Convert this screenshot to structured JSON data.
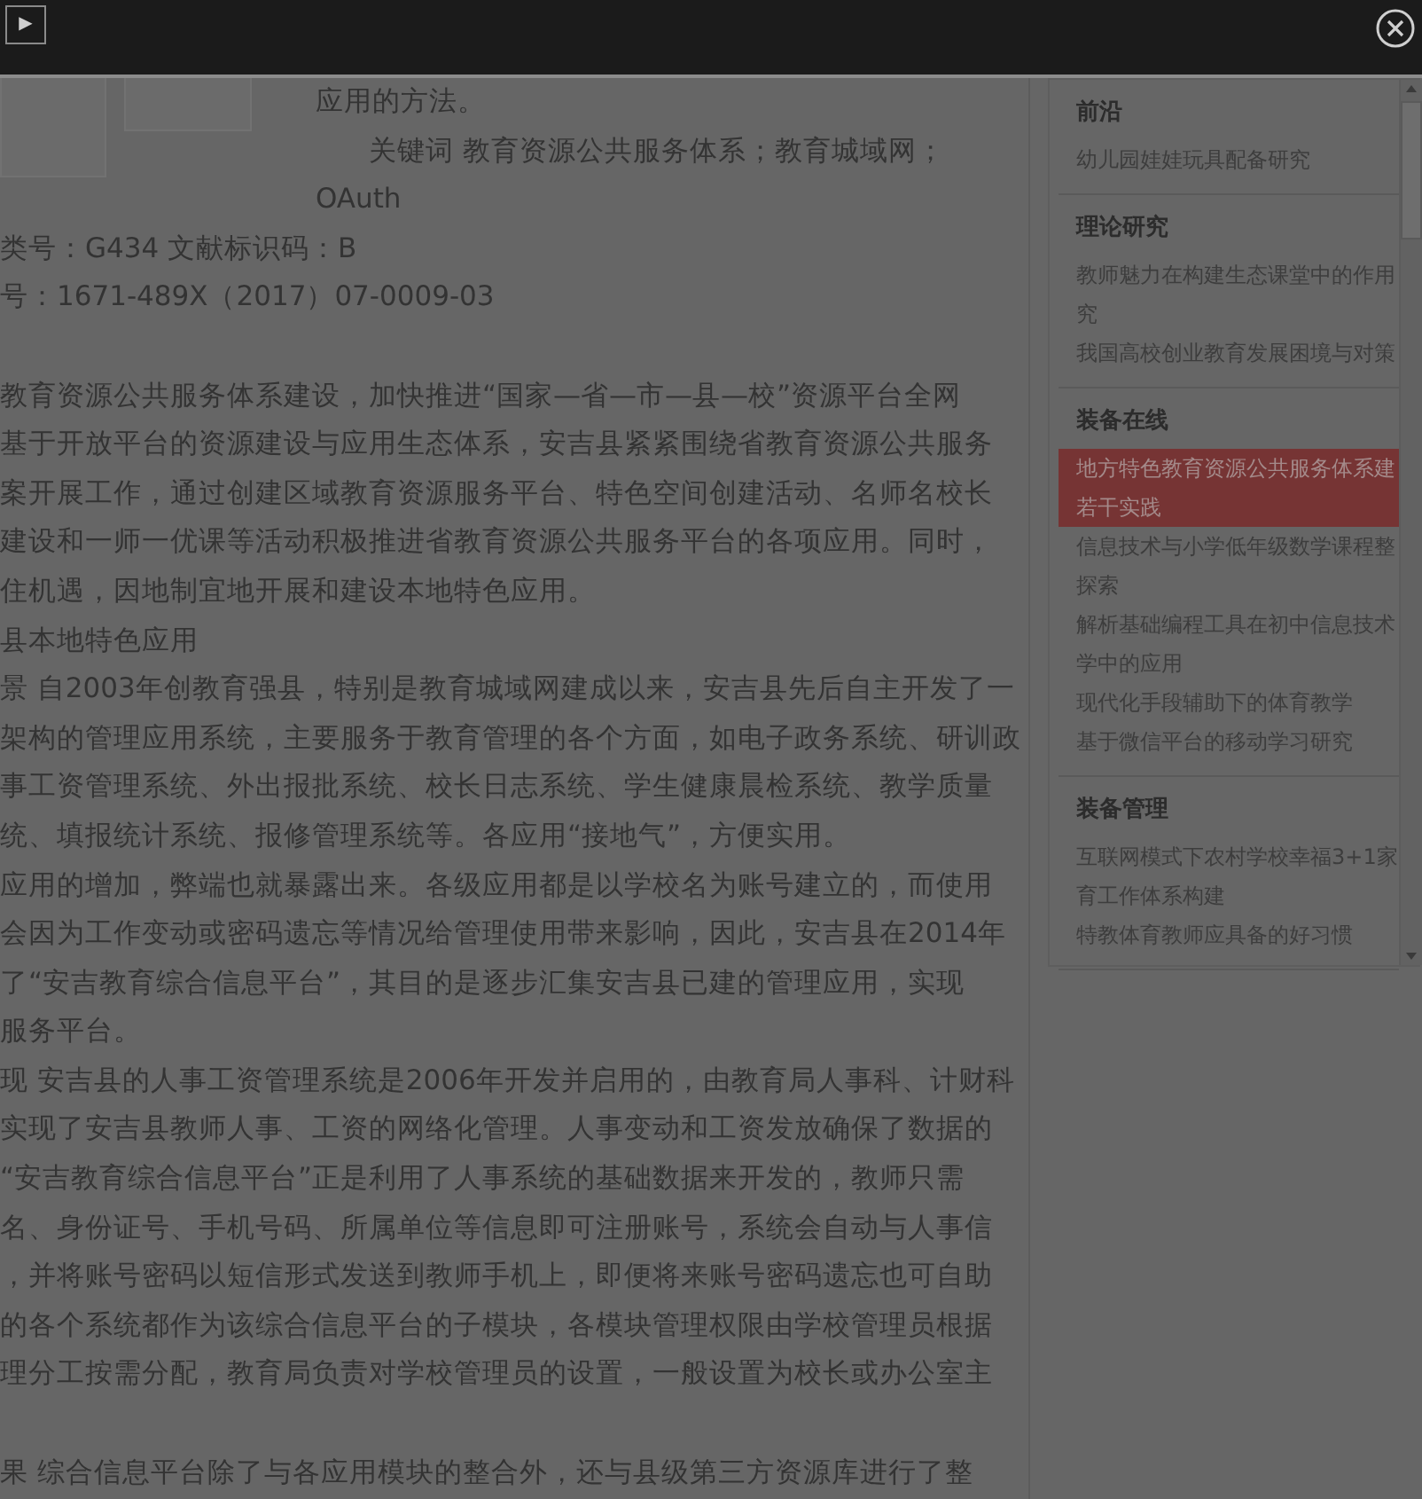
{
  "viewer_bar": {
    "play_label": "▶"
  },
  "article": {
    "abstract_lines": [
      {
        "kind": "text",
        "text": "应用的方法。"
      },
      {
        "kind": "keywords",
        "text": "关键词 教育资源公共服务体系；教育城域网；"
      },
      {
        "kind": "text",
        "text": "OAuth"
      }
    ],
    "meta_lines": [
      "类号：G434 文献标识码：B",
      "号：1671-489X（2017）07-0009-03"
    ],
    "blocks": [
      [
        "教育资源公共服务体系建设，加快推进“国家—省—市—县—校”资源平台全网",
        "基于开放平台的资源建设与应用生态体系，安吉县紧紧围绕省教育资源公共服务",
        "案开展工作，通过创建区域教育资源服务平台、特色空间创建活动、名师名校长",
        "建设和一师一优课等活动积极推进省教育资源公共服务平台的各项应用。同时，",
        "住机遇，因地制宜地开展和建设本地特色应用。",
        "县本地特色应用",
        "景 自2003年创教育强县，特别是教育城域网建成以来，安吉县先后自主开发了一",
        "架构的管理应用系统，主要服务于教育管理的各个方面，如电子政务系统、研训政",
        "事工资管理系统、外出报批系统、校长日志系统、学生健康晨检系统、教学质量",
        "统、填报统计系统、报修管理系统等。各应用“接地气”，方便实用。",
        "应用的增加，弊端也就暴露出来。各级应用都是以学校名为账号建立的，而使用",
        "会因为工作变动或密码遗忘等情况给管理使用带来影响，因此，安吉县在2014年",
        "了“安吉教育综合信息平台”，其目的是逐步汇集安吉县已建的管理应用，实现",
        "服务平台。",
        "现 安吉县的人事工资管理系统是2006年开发并启用的，由教育局人事科、计财科",
        "实现了安吉县教师人事、工资的网络化管理。人事变动和工资发放确保了数据的",
        "“安吉教育综合信息平台”正是利用了人事系统的基础数据来开发的，教师只需",
        "名、身份证号、手机号码、所属单位等信息即可注册账号，系统会自动与人事信",
        "，并将账号密码以短信形式发送到教师手机上，即便将来账号密码遗忘也可自助",
        "的各个系统都作为该综合信息平台的子模块，各模块管理权限由学校管理员根据",
        "理分工按需分配，教育局负责对学校管理员的设置，一般设置为校长或办公室主"
      ],
      [
        "果 综合信息平台除了与各应用模块的整合外，还与县级第三方资源库进行了整"
      ]
    ]
  },
  "sidebar": {
    "sections": [
      {
        "heading": "前沿",
        "items": [
          {
            "lines": [
              "幼儿园娃娃玩具配备研究"
            ],
            "selected": false
          }
        ]
      },
      {
        "heading": "理论研究",
        "items": [
          {
            "lines": [
              "教师魅力在构建生态课堂中的作用",
              "究"
            ],
            "selected": false
          },
          {
            "lines": [
              "我国高校创业教育发展困境与对策"
            ],
            "selected": false
          }
        ]
      },
      {
        "heading": "装备在线",
        "items": [
          {
            "lines": [
              "地方特色教育资源公共服务体系建",
              "若干实践"
            ],
            "selected": true
          },
          {
            "lines": [
              "信息技术与小学低年级数学课程整",
              "探索"
            ],
            "selected": false
          },
          {
            "lines": [
              "解析基础编程工具在初中信息技术",
              "学中的应用"
            ],
            "selected": false
          },
          {
            "lines": [
              "现代化手段辅助下的体育教学"
            ],
            "selected": false
          },
          {
            "lines": [
              "基于微信平台的移动学习研究"
            ],
            "selected": false
          }
        ]
      },
      {
        "heading": "装备管理",
        "items": [
          {
            "lines": [
              "互联网模式下农村学校幸福3+1家",
              "育工作体系构建"
            ],
            "selected": false
          },
          {
            "lines": [
              "特教体育教师应具备的好习惯"
            ],
            "selected": false
          }
        ]
      }
    ]
  }
}
